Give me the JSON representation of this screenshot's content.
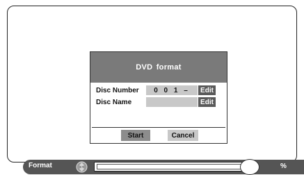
{
  "dialog": {
    "title": "DVD  format",
    "disc_number_label": "Disc Number",
    "disc_number_value": "0 0 1 –",
    "disc_name_label": "Disc Name",
    "disc_name_value": "",
    "edit_label": "Edit",
    "start_label": "Start",
    "cancel_label": "Cancel"
  },
  "status": {
    "label": "Format",
    "progress_percent": 0,
    "percent_symbol": "%",
    "icon": "disc-icon"
  },
  "colors": {
    "title_bg": "#7a7a7a",
    "field_bg": "#c8c8c8",
    "edit_bg": "#5a5a5a",
    "statusbar_bg": "#555555"
  }
}
